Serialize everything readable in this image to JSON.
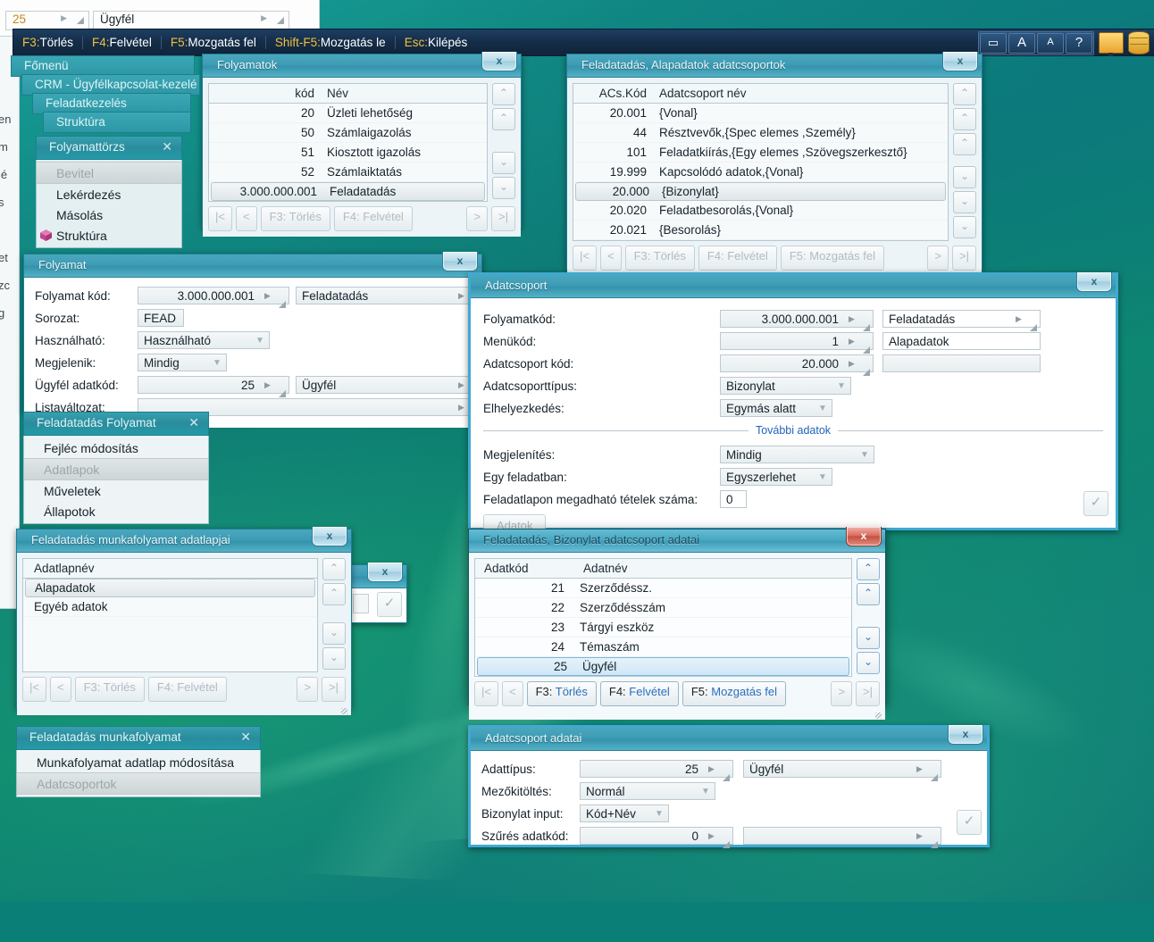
{
  "app": {
    "menubar": [
      {
        "hotkey": "F3:",
        "label": "Törlés"
      },
      {
        "hotkey": "F4:",
        "label": "Felvétel"
      },
      {
        "hotkey": "F5:",
        "label": "Mozgatás fel"
      },
      {
        "hotkey": "Shift-F5:",
        "label": "Mozgatás le"
      },
      {
        "hotkey": "Esc:",
        "label": "Kilépés"
      }
    ],
    "toolbar": [
      {
        "name": "window-icon",
        "glyph": "▭"
      },
      {
        "name": "font-large-icon",
        "glyph": "A"
      },
      {
        "name": "font-small-icon",
        "glyph": "A"
      },
      {
        "name": "help-icon",
        "glyph": "?"
      }
    ],
    "tray": [
      {
        "name": "monitor-icon"
      },
      {
        "name": "database-icon"
      }
    ],
    "close_glyph": "x"
  },
  "behind_field": {
    "code": "25",
    "name": "Ügyfél"
  },
  "cascade_menu": {
    "levels": [
      {
        "label": "Főmenü"
      },
      {
        "label": "CRM - Ügyfélkapcsolat-kezelé"
      },
      {
        "label": "Feladatkezelés"
      },
      {
        "label": "Struktúra"
      }
    ],
    "panel": {
      "title": "Folyamattörzs",
      "close": "✕",
      "items": [
        {
          "label": "Bevitel",
          "state": "disabled"
        },
        {
          "label": "Lekérdezés",
          "state": "normal"
        },
        {
          "label": "Másolás",
          "state": "normal"
        },
        {
          "label": "Struktúra",
          "state": "normal",
          "icon": "cube-icon"
        }
      ]
    }
  },
  "folyamatok_window": {
    "title": "Folyamatok",
    "columns": [
      "kód",
      "Név"
    ],
    "rows": [
      {
        "code": "20",
        "name": "Üzleti lehetőség",
        "selected": false
      },
      {
        "code": "50",
        "name": "Számlaigazolás",
        "selected": false
      },
      {
        "code": "51",
        "name": "Kiosztott igazolás",
        "selected": false
      },
      {
        "code": "52",
        "name": "Számlaiktatás",
        "selected": false
      },
      {
        "code": "3.000.000.001",
        "name": "Feladatadás",
        "selected": true
      }
    ],
    "buttons": [
      {
        "label": "|<",
        "type": "nav"
      },
      {
        "label": "<",
        "type": "nav"
      },
      {
        "hotkey": "F3:",
        "label": "Törlés"
      },
      {
        "hotkey": "F4:",
        "label": "Felvétel"
      },
      {
        "label": ">",
        "type": "nav"
      },
      {
        "label": ">|",
        "type": "nav"
      }
    ]
  },
  "adatcsoportok_window": {
    "title": "Feladatadás, Alapadatok adatcsoportok",
    "columns": [
      "ACs.Kód",
      "Adatcsoport név"
    ],
    "rows": [
      {
        "code": "20.001",
        "name": "{Vonal}",
        "selected": false
      },
      {
        "code": "44",
        "name": "Résztvevők,{Spec elemes ,Személy}",
        "selected": false
      },
      {
        "code": "101",
        "name": "Feladatkiírás,{Egy elemes ,Szövegszerkesztő}",
        "selected": false
      },
      {
        "code": "19.999",
        "name": "Kapcsolódó adatok,{Vonal}",
        "selected": false
      },
      {
        "code": "20.000",
        "name": "{Bizonylat}",
        "selected": true
      },
      {
        "code": "20.020",
        "name": "Feladatbesorolás,{Vonal}",
        "selected": false
      },
      {
        "code": "20.021",
        "name": "{Besorolás}",
        "selected": false
      }
    ],
    "buttons": [
      {
        "label": "|<",
        "type": "nav"
      },
      {
        "label": "<",
        "type": "nav"
      },
      {
        "hotkey": "F3:",
        "label": "Törlés"
      },
      {
        "hotkey": "F4:",
        "label": "Felvétel"
      },
      {
        "hotkey": "F5:",
        "label": "Mozgatás fel"
      },
      {
        "label": ">",
        "type": "nav"
      },
      {
        "label": ">|",
        "type": "nav"
      }
    ]
  },
  "folyamat_form": {
    "title": "Folyamat",
    "fields": [
      {
        "label": "Folyamat kód:",
        "value": "3.000.000.001",
        "align": "right",
        "lookup": true,
        "second": "Feladatadás",
        "second_lookup": true
      },
      {
        "label": "Sorozat:",
        "value": "FEAD",
        "align": "left",
        "kind": "text"
      },
      {
        "label": "Használható:",
        "value": "Használható",
        "kind": "select"
      },
      {
        "label": "Megjelenik:",
        "value": "Mindig",
        "kind": "select"
      },
      {
        "label": "Ügyfél adatkód:",
        "value": "25",
        "align": "right",
        "lookup": true,
        "second": "Ügyfél",
        "second_lookup": true
      },
      {
        "label": "Listaváltozat:",
        "value": "",
        "kind": "wide"
      }
    ]
  },
  "adatcsoport_dialog": {
    "title": "Adatcsoport",
    "fields": [
      {
        "label": "Folyamatkód:",
        "value": "3.000.000.001",
        "second": "Feladatadás"
      },
      {
        "label": "Menükód:",
        "value": "1",
        "second": "Alapadatok"
      },
      {
        "label": "Adatcsoport kód:",
        "value": "20.000",
        "second": ""
      },
      {
        "label": "Adatcsoporttípus:",
        "value": "Bizonylat",
        "kind": "select"
      },
      {
        "label": "Elhelyezkedés:",
        "value": "Egymás alatt",
        "kind": "select"
      }
    ],
    "divider": "További adatok",
    "fields2": [
      {
        "label": "Megjelenítés:",
        "value": "Mindig",
        "kind": "select"
      },
      {
        "label": "Egy feladatban:",
        "value": "Egyszerlehet",
        "kind": "select"
      },
      {
        "label": "Feladatlapon megadható tételek száma:",
        "value": "0",
        "kind": "text"
      }
    ],
    "action_button": "Adatok",
    "ok_glyph": "✓"
  },
  "folyamat_menu": {
    "title": "Feladatadás Folyamat",
    "close": "✕",
    "items": [
      {
        "label": "Fejléc módosítás",
        "state": "normal"
      },
      {
        "label": "Adatlapok",
        "state": "disabled"
      },
      {
        "label": "Műveletek",
        "state": "normal"
      },
      {
        "label": "Állapotok",
        "state": "normal"
      }
    ]
  },
  "adatlapjai_window": {
    "title": "Feladatadás munkafolyamat adatlapjai",
    "columns": [
      "Adatlapnév"
    ],
    "rows": [
      {
        "name": "Alapadatok",
        "selected": true
      },
      {
        "name": "Egyéb adatok",
        "selected": false
      }
    ],
    "buttons": [
      {
        "label": "|<",
        "type": "nav"
      },
      {
        "label": "<",
        "type": "nav"
      },
      {
        "hotkey": "F3:",
        "label": "Törlés"
      },
      {
        "hotkey": "F4:",
        "label": "Felvétel"
      },
      {
        "label": ">",
        "type": "nav"
      },
      {
        "label": ">|",
        "type": "nav"
      }
    ]
  },
  "bizonylat_window": {
    "title": "Feladatadás, Bizonylat adatcsoport adatai",
    "active": true,
    "columns": [
      "Adatkód",
      "Adatnév"
    ],
    "rows": [
      {
        "code": "21",
        "name": "Szerződéssz.",
        "selected": false
      },
      {
        "code": "22",
        "name": "Szerződésszám",
        "selected": false
      },
      {
        "code": "23",
        "name": "Tárgyi eszköz",
        "selected": false
      },
      {
        "code": "24",
        "name": "Témaszám",
        "selected": false
      },
      {
        "code": "25",
        "name": "Ügyfél",
        "selected": true
      }
    ],
    "buttons": [
      {
        "label": "|<",
        "type": "nav"
      },
      {
        "label": "<",
        "type": "nav"
      },
      {
        "hotkey": "F3:",
        "label": "Törlés",
        "active": true
      },
      {
        "hotkey": "F4:",
        "label": "Felvétel",
        "active": true
      },
      {
        "hotkey": "F5:",
        "label": "Mozgatás fel",
        "active": true
      },
      {
        "label": ">",
        "type": "nav"
      },
      {
        "label": ">|",
        "type": "nav"
      }
    ]
  },
  "munkafolyamat_menu": {
    "title": "Feladatadás munkafolyamat",
    "close": "✕",
    "items": [
      {
        "label": "Munkafolyamat adatlap módosítása",
        "state": "normal"
      },
      {
        "label": "Adatcsoportok",
        "state": "disabled"
      }
    ]
  },
  "adatcsoport_adatai": {
    "title": "Adatcsoport adatai",
    "fields": [
      {
        "label": "Adattípus:",
        "value": "25",
        "second": "Ügyfél"
      },
      {
        "label": "Mezőkitöltés:",
        "value": "Normál",
        "kind": "select"
      },
      {
        "label": "Bizonylat input:",
        "value": "Kód+Név",
        "kind": "select"
      },
      {
        "label": "Szűrés adatkód:",
        "value": "0",
        "second": ""
      }
    ],
    "ok_glyph": "✓"
  },
  "colors": {
    "desktop": "#0e8a80",
    "titlebar": "#3d9cb5",
    "menu_header": "#2a8c9c",
    "menubar": "#152c47",
    "hotkey": "#f0c040",
    "active_close": "#c2503f",
    "link": "#1f63b8",
    "selection_blue": "#cfe7f7"
  }
}
